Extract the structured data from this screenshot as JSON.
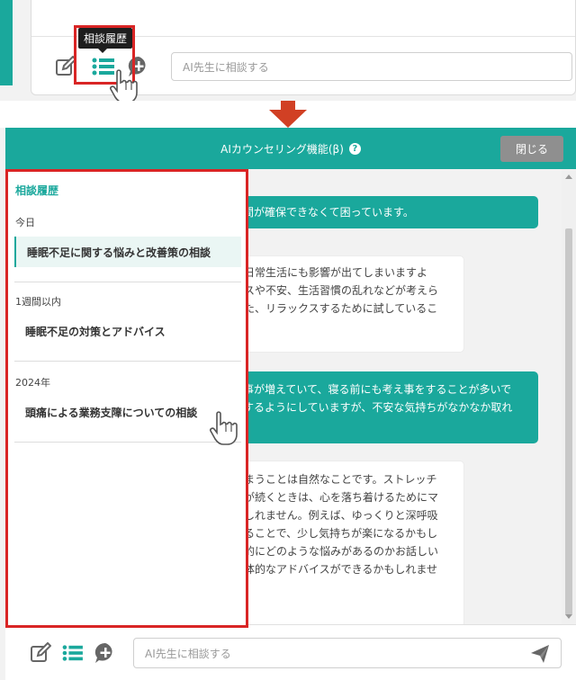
{
  "top": {
    "tooltip": "相談履歴",
    "input_placeholder": "AI先生に相談する",
    "icons": [
      "edit-icon",
      "list-icon",
      "add-chat-icon"
    ]
  },
  "chat": {
    "title": "AIカウンセリング機能(β)",
    "help_icon": "?",
    "close_label": "閉じる",
    "messages": [
      {
        "role": "user",
        "lines": [
          "間が確保できなくて困っています。"
        ]
      },
      {
        "role": "ai",
        "lines": [
          "日常生活にも影響が出てしまいますよ",
          "スや不安、生活習慣の乱れなどが考えら",
          "た、リラックスするために試しているこ"
        ]
      },
      {
        "role": "user",
        "lines": [
          "事が増えていて、寝る前にも考え事をすることが多いで",
          "するようにしていますが、不安な気持ちがなかなか取れ"
        ]
      },
      {
        "role": "ai",
        "lines": [
          "まうことは自然なことです。ストレッチ",
          "が続くときは、心を落ち着けるためにマ",
          "しれません。例えば、ゆっくりと深呼吸",
          "ることで、少し気持ちが楽になるかもし",
          "的にどのような悩みがあるのかお話しい",
          "体的なアドバイスができるかもしれませ"
        ]
      }
    ],
    "input_placeholder": "AI先生に相談する"
  },
  "history": {
    "title": "相談履歴",
    "groups": [
      {
        "label": "今日",
        "items": [
          "睡眠不足に関する悩みと改善策の相談"
        ]
      },
      {
        "label": "1週間以内",
        "items": [
          "睡眠不足の対策とアドバイス"
        ]
      },
      {
        "label": "2024年",
        "items": [
          "頭痛による業務支障についての相談"
        ]
      }
    ]
  },
  "colors": {
    "accent": "#1aa89c",
    "highlight": "#d92525",
    "close_button": "#8f8f8f"
  }
}
